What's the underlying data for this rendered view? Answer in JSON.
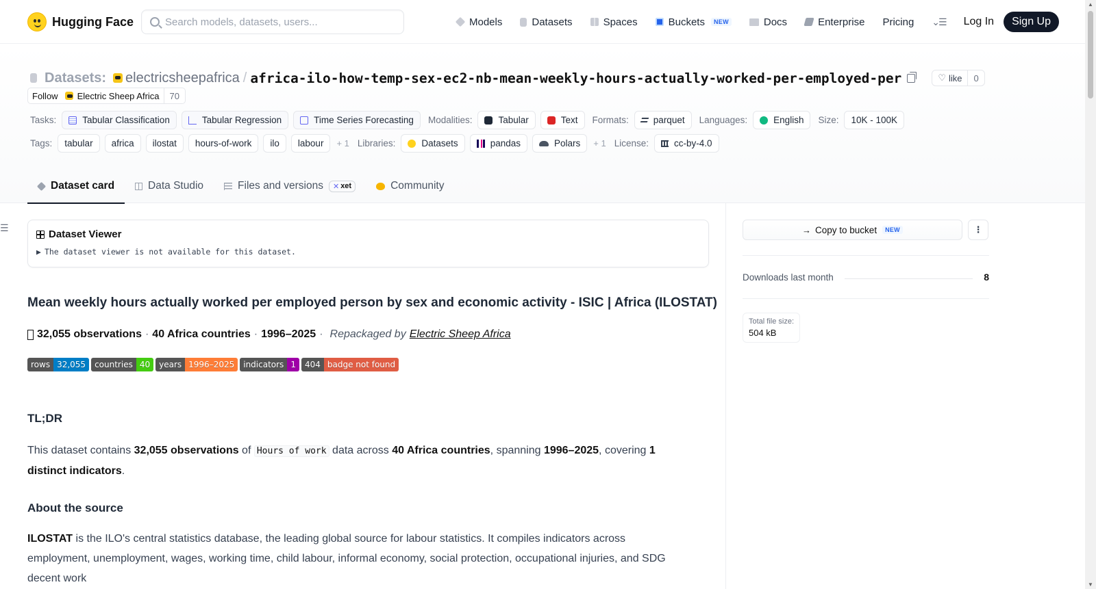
{
  "nav": {
    "brand": "Hugging Face",
    "search_placeholder": "Search models, datasets, users...",
    "links": [
      "Models",
      "Datasets",
      "Spaces",
      "Buckets",
      "Docs",
      "Enterprise",
      "Pricing"
    ],
    "buckets_badge": "NEW",
    "login": "Log In",
    "signup": "Sign Up"
  },
  "header": {
    "datasets_label": "Datasets:",
    "org": "electricsheepafrica",
    "slash": "/",
    "repo": "africa-ilo-how-temp-sex-ec2-nb-mean-weekly-hours-actually-worked-per-employed-per",
    "like_label": "like",
    "like_count": "0",
    "follow_label": "Follow",
    "org_display": "Electric Sheep Africa",
    "followers": "70",
    "tasks_label": "Tasks:",
    "tasks": [
      "Tabular Classification",
      "Tabular Regression",
      "Time Series Forecasting"
    ],
    "modalities_label": "Modalities:",
    "modalities": [
      "Tabular",
      "Text"
    ],
    "formats_label": "Formats:",
    "formats": [
      "parquet"
    ],
    "languages_label": "Languages:",
    "languages": [
      "English"
    ],
    "size_label": "Size:",
    "size": "10K - 100K",
    "tags_label": "Tags:",
    "tags": [
      "tabular",
      "africa",
      "ilostat",
      "hours-of-work",
      "ilo",
      "labour"
    ],
    "tags_more": "+ 1",
    "libraries_label": "Libraries:",
    "libraries": [
      "Datasets",
      "pandas",
      "Polars"
    ],
    "libraries_more": "+ 1",
    "license_label": "License:",
    "license": "cc-by-4.0"
  },
  "tabs": {
    "card": "Dataset card",
    "studio": "Data Studio",
    "files": "Files and versions",
    "xet": "xet",
    "community": "Community"
  },
  "viewer": {
    "title": "Dataset Viewer",
    "arrow": "▶",
    "message": "The dataset viewer is not available for this dataset."
  },
  "content": {
    "heading": "Mean weekly hours actually worked per employed person by sex and economic activity - ISIC | Africa (ILOSTAT)",
    "stat_obs": "32,055 observations",
    "stat_countries": "40 Africa countries",
    "stat_years": "1996–2025",
    "stat_sep": "·",
    "repackaged": "Repackaged by",
    "repackaged_link": "Electric Sheep Africa",
    "badges": [
      {
        "label": "rows",
        "value": "32,055",
        "color": "#007ec6"
      },
      {
        "label": "countries",
        "value": "40",
        "color": "#4c1"
      },
      {
        "label": "years",
        "value": "1996–2025",
        "color": "#fe7d37"
      },
      {
        "label": "indicators",
        "value": "1",
        "color": "#9f00a7"
      },
      {
        "label": "404",
        "value": "badge not found",
        "color": "#e05d44"
      }
    ],
    "tldr_heading": "TL;DR",
    "tldr": {
      "t1": "This dataset contains ",
      "b1": "32,055 observations",
      "t2": " of ",
      "code": "Hours of work",
      "t3": " data across ",
      "b2": "40 Africa countries",
      "t4": ", spanning ",
      "b3": "1996–2025",
      "t5": ", covering ",
      "b4": "1 distinct indicators",
      "t6": "."
    },
    "about_heading": "About the source",
    "about": {
      "b1": "ILOSTAT",
      "t1": " is the ILO's central statistics database, the leading global source for labour statistics. It compiles indicators across employment, unemployment, wages, working time, child labour, informal economy, social protection, occupational injuries, and SDG decent work"
    }
  },
  "sidebar": {
    "copy_label": "Copy to bucket",
    "copy_badge": "NEW",
    "dots": "⋮",
    "downloads_label": "Downloads last month",
    "downloads_value": "8",
    "file_size_label": "Total file size:",
    "file_size_value": "504 kB"
  }
}
